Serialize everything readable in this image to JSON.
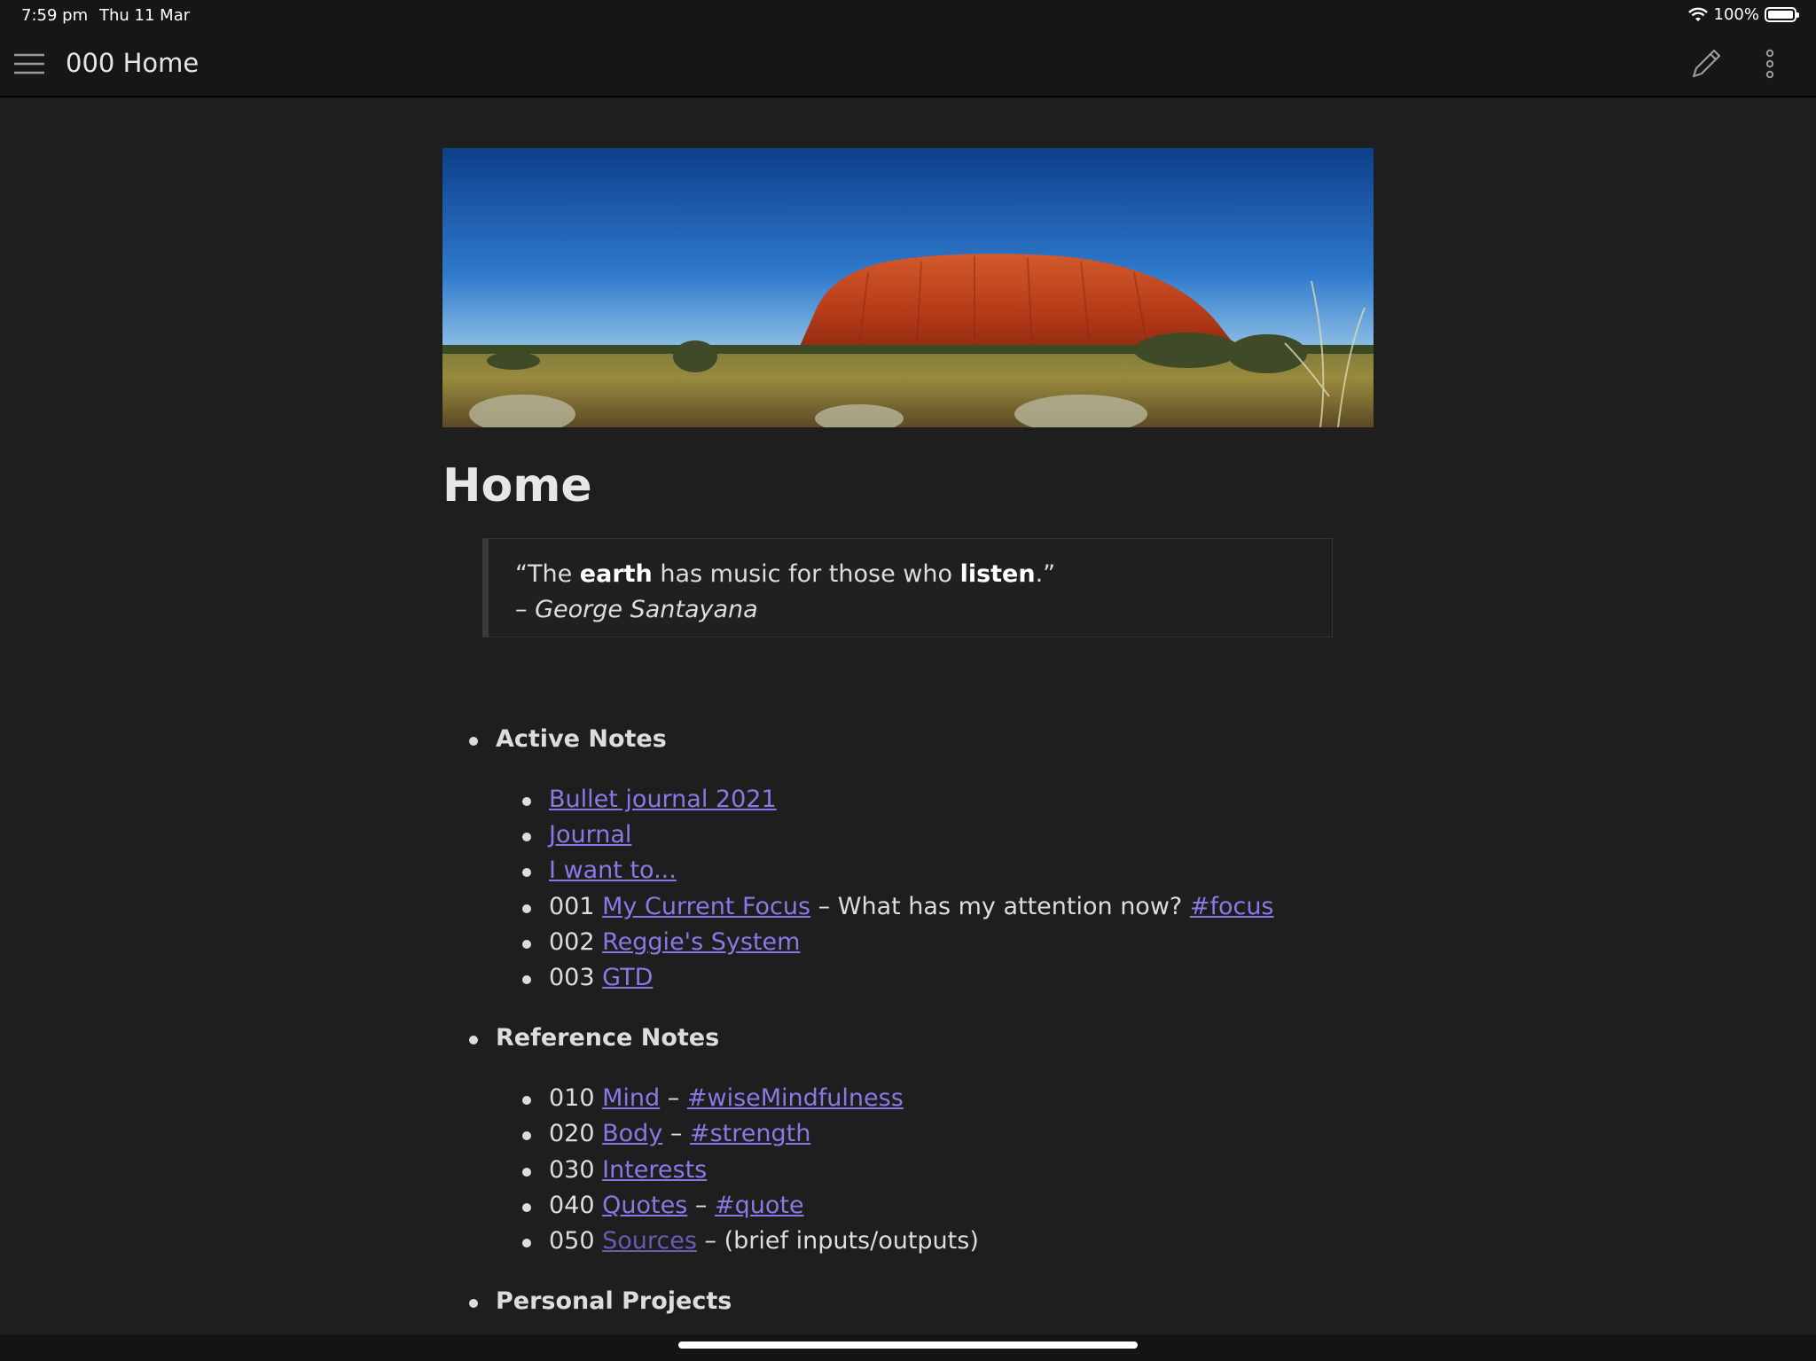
{
  "status": {
    "time": "7:59 pm",
    "date": "Thu 11 Mar",
    "battery": "100%",
    "battery_level": 1.0
  },
  "topbar": {
    "title": "000 Home",
    "menu_icon": "hamburger-menu-icon",
    "edit_icon": "pencil-icon",
    "more_icon": "vertical-ellipsis-icon"
  },
  "page": {
    "title": "Home",
    "quote": {
      "open": "“The ",
      "bold1": "earth",
      "mid": " has music for those who ",
      "bold2": "listen",
      "close": ".”",
      "author": "– George Santayana"
    }
  },
  "sections": {
    "active": {
      "label": "Active Notes",
      "bullet_journal": "Bullet journal 2021",
      "journal": "Journal",
      "want": "I want to...",
      "focus_num": "001 ",
      "focus_link": "My Current Focus",
      "focus_text": " – What has my attention now? ",
      "focus_tag": "#focus",
      "reggie_num": "002 ",
      "reggie_link": "Reggie's System",
      "gtd_num": "003 ",
      "gtd_link": "GTD"
    },
    "reference": {
      "label": "Reference Notes",
      "mind_num": "010 ",
      "mind_link": "Mind",
      "mind_sep": " – ",
      "mind_tag": "#wiseMindfulness",
      "body_num": "020 ",
      "body_link": "Body",
      "body_sep": " – ",
      "body_tag": "#strength",
      "interests_num": "030 ",
      "interests_link": "Interests",
      "quotes_num": "040 ",
      "quotes_link": "Quotes",
      "quotes_sep": " – ",
      "quotes_tag": "#quote",
      "sources_num": "050 ",
      "sources_link": "Sources",
      "sources_text": " – (brief inputs/outputs)"
    },
    "personal": {
      "label": "Personal Projects"
    }
  },
  "colors": {
    "background": "#1e1e1e",
    "link": "#8b78e6",
    "text": "#dcddde"
  }
}
